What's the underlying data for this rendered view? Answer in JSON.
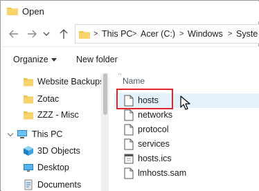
{
  "window": {
    "title": "Open"
  },
  "icons": {
    "window": "folder-icon",
    "back": "back-arrow-icon",
    "forward": "forward-arrow-icon",
    "history": "chevron-down-icon",
    "up": "up-arrow-icon",
    "file": "document-icon"
  },
  "colors": {
    "folder": "#f0c44a",
    "highlight": "#e5f1fb",
    "callout": "#e0262c",
    "accent": "#2a82da"
  },
  "breadcrumb": {
    "segments": [
      "This PC",
      "Acer (C:)",
      "Windows",
      "Syste"
    ],
    "separator": ">"
  },
  "toolbar": {
    "organize_label": "Organize",
    "new_folder_label": "New folder"
  },
  "nav_pane": {
    "items": [
      {
        "label": "Website Backups",
        "icon": "folder-icon"
      },
      {
        "label": "Zotac",
        "icon": "folder-icon"
      },
      {
        "label": "ZZZ - Misc",
        "icon": "folder-icon"
      },
      {
        "label": "This PC",
        "icon": "this-pc-icon"
      },
      {
        "label": "3D Objects",
        "icon": "3d-objects-icon"
      },
      {
        "label": "Desktop",
        "icon": "desktop-icon"
      },
      {
        "label": "Documents",
        "icon": "documents-icon"
      }
    ]
  },
  "file_list": {
    "column_header": "Name",
    "files": [
      {
        "name": "hosts",
        "selected": true
      },
      {
        "name": "networks"
      },
      {
        "name": "protocol"
      },
      {
        "name": "services"
      },
      {
        "name": "hosts.ics"
      },
      {
        "name": "lmhosts.sam"
      }
    ]
  }
}
